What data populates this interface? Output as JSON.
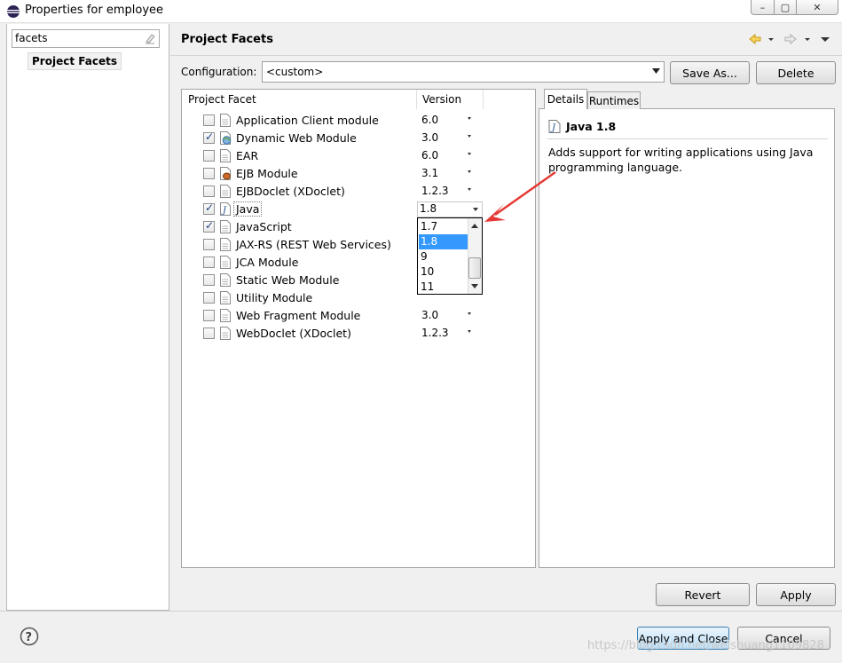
{
  "window": {
    "title": "Properties for employee",
    "controls": {
      "minimize": "–",
      "maximize": "▢",
      "close": "✕"
    }
  },
  "sidebar": {
    "filter_value": "facets",
    "tree_item": "Project Facets"
  },
  "header": {
    "title": "Project Facets"
  },
  "configuration": {
    "label": "Configuration:",
    "value": "<custom>",
    "save_as": "Save As...",
    "delete": "Delete"
  },
  "facets": {
    "col_facet": "Project Facet",
    "col_version": "Version",
    "rows": [
      {
        "name": "Application Client module",
        "version": "6.0",
        "checked": false,
        "icon": "page-icon"
      },
      {
        "name": "Dynamic Web Module",
        "version": "3.0",
        "checked": true,
        "icon": "web-globe-icon"
      },
      {
        "name": "EAR",
        "version": "6.0",
        "checked": false,
        "icon": "page-icon"
      },
      {
        "name": "EJB Module",
        "version": "3.1",
        "checked": false,
        "icon": "bean-icon"
      },
      {
        "name": "EJBDoclet (XDoclet)",
        "version": "1.2.3",
        "checked": false,
        "icon": "page-icon"
      },
      {
        "name": "Java",
        "version": "1.8",
        "checked": true,
        "icon": "java-file-icon"
      },
      {
        "name": "JavaScript",
        "version": "",
        "checked": true,
        "icon": "page-icon"
      },
      {
        "name": "JAX-RS (REST Web Services)",
        "version": "",
        "checked": false,
        "icon": "page-icon"
      },
      {
        "name": "JCA Module",
        "version": "",
        "checked": false,
        "icon": "page-icon"
      },
      {
        "name": "Static Web Module",
        "version": "",
        "checked": false,
        "icon": "page-icon"
      },
      {
        "name": "Utility Module",
        "version": "",
        "checked": false,
        "icon": "page-icon"
      },
      {
        "name": "Web Fragment Module",
        "version": "3.0",
        "checked": false,
        "icon": "page-icon"
      },
      {
        "name": "WebDoclet (XDoclet)",
        "version": "1.2.3",
        "checked": false,
        "icon": "page-icon"
      }
    ],
    "java_dropdown": {
      "current": "1.8",
      "options": [
        "1.7",
        "1.8",
        "9",
        "10",
        "11"
      ],
      "selected": "1.8"
    }
  },
  "details": {
    "tab_details": "Details",
    "tab_runtimes": "Runtimes",
    "title": "Java 1.8",
    "description": "Adds support for writing applications using Java programming language."
  },
  "footer": {
    "revert": "Revert",
    "apply": "Apply",
    "apply_close": "Apply and Close",
    "cancel": "Cancel",
    "watermark": "https://blog.csdn.net/weishuang1109828"
  },
  "colors": {
    "selection": "#3399ff",
    "annotation_arrow": "#e53935",
    "default_button_border": "#3c7fb1"
  }
}
